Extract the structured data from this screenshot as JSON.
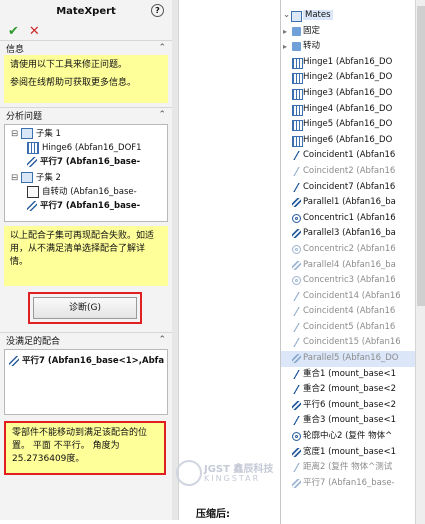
{
  "panel": {
    "title": "MateXpert",
    "help": "?",
    "ok": "✔",
    "cancel": "✕",
    "info_header": "信息",
    "info_line1": "请使用以下工具来修正问题。",
    "info_line2": "参阅在线帮助可获取更多信息。",
    "analyze_header": "分析问题",
    "tree": [
      {
        "text": "子集 1",
        "bold": false
      },
      {
        "text": "Hinge6 (Abfan16_DOF1",
        "bold": false
      },
      {
        "text": "平行7 (Abfan16_base-",
        "bold": true
      },
      {
        "text": "子集 2",
        "bold": false
      },
      {
        "text": "自转动 (Abfan16_base-",
        "bold": false
      },
      {
        "text": "平行7 (Abfan16_base-",
        "bold": true
      }
    ],
    "hint": "以上配合子集可再现配合失败。如适用，从不满足清单选择配合了解详情。",
    "diagnose_button": "诊断(G)",
    "unsat_header": "没满足的配合",
    "unsat_item": "平行7 (Abfan16_base<1>,Abfa",
    "message": "零部件不能移动到满足该配合的位置。 平面 不平行。 角度为 25.2736409度。"
  },
  "watermark": {
    "brand_cn": "JGST 鑫辰科技",
    "brand_en": "KINGSTAR"
  },
  "caption": "压缩后:",
  "mates_tree": {
    "root": "Mates",
    "items": [
      {
        "label": "固定",
        "icon": "folder-icon",
        "grey": false
      },
      {
        "label": "转动",
        "icon": "folder-icon",
        "grey": false
      },
      {
        "label": "Hinge1 (Abfan16_DO",
        "icon": "hinge-icon",
        "grey": false
      },
      {
        "label": "Hinge2 (Abfan16_DO",
        "icon": "hinge-icon",
        "grey": false
      },
      {
        "label": "Hinge3 (Abfan16_DO",
        "icon": "hinge-icon",
        "grey": false
      },
      {
        "label": "Hinge4 (Abfan16_DO",
        "icon": "hinge-icon",
        "grey": false
      },
      {
        "label": "Hinge5 (Abfan16_DO",
        "icon": "hinge-icon",
        "grey": false
      },
      {
        "label": "Hinge6 (Abfan16_DO",
        "icon": "hinge-icon",
        "grey": false
      },
      {
        "label": "Coincident1 (Abfan16",
        "icon": "coincident-icon",
        "grey": false
      },
      {
        "label": "Coincident2 (Abfan16",
        "icon": "coincident-icon",
        "grey": true
      },
      {
        "label": "Coincident7 (Abfan16",
        "icon": "coincident-icon",
        "grey": false
      },
      {
        "label": "Parallel1 (Abfan16_ba",
        "icon": "parallel-icon",
        "grey": false
      },
      {
        "label": "Concentric1 (Abfan16",
        "icon": "concentric-icon",
        "grey": false
      },
      {
        "label": "Parallel3 (Abfan16_ba",
        "icon": "parallel-icon",
        "grey": false
      },
      {
        "label": "Concentric2 (Abfan16",
        "icon": "concentric-icon",
        "grey": true
      },
      {
        "label": "Parallel4 (Abfan16_ba",
        "icon": "parallel-icon",
        "grey": true
      },
      {
        "label": "Concentric3 (Abfan16",
        "icon": "concentric-icon",
        "grey": true
      },
      {
        "label": "Coincident14 (Abfan16",
        "icon": "coincident-icon",
        "grey": true
      },
      {
        "label": "Coincident4 (Abfan16",
        "icon": "coincident-icon",
        "grey": true
      },
      {
        "label": "Coincident5 (Abfan16",
        "icon": "coincident-icon",
        "grey": true
      },
      {
        "label": "Coincident15 (Abfan16",
        "icon": "coincident-icon",
        "grey": true
      },
      {
        "label": "Parallel5 (Abfan16_DO",
        "icon": "parallel-icon",
        "grey": true,
        "selected": true
      },
      {
        "label": "重合1 (mount_base<1",
        "icon": "coincident-icon",
        "grey": false
      },
      {
        "label": "重合2 (mount_base<2",
        "icon": "coincident-icon",
        "grey": false
      },
      {
        "label": "平行6 (mount_base<2",
        "icon": "parallel-icon",
        "grey": false
      },
      {
        "label": "重合3 (mount_base<1",
        "icon": "coincident-icon",
        "grey": false
      },
      {
        "label": "轮廓中心2 (复件 物体^",
        "icon": "profile-center-icon",
        "grey": false
      },
      {
        "label": "宽度1 (mount_base<1",
        "icon": "width-icon",
        "grey": false
      },
      {
        "label": "距离2 (复件 物体^测试",
        "icon": "distance-icon",
        "grey": true
      },
      {
        "label": "平行7 (Abfan16_base-",
        "icon": "parallel-icon",
        "grey": true
      }
    ]
  }
}
